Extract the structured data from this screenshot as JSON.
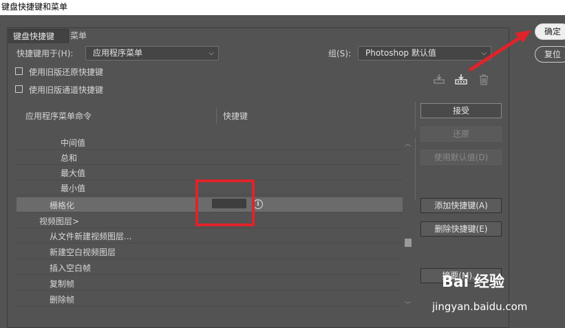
{
  "window": {
    "title": "键盘快捷键和菜单"
  },
  "tabs": [
    {
      "label": "键盘快捷键"
    },
    {
      "label": "菜单"
    }
  ],
  "shortcuts_for": {
    "label": "快捷键用于(H):",
    "value": "应用程序菜单"
  },
  "group": {
    "label": "组(S):",
    "value": "Photoshop 默认值"
  },
  "options": {
    "legacy_undo": "使用旧版还原快捷键",
    "legacy_channel": "使用旧版通道快捷键"
  },
  "icons": {
    "save_set": "save-set-icon",
    "save_as_set": "save-as-set-icon",
    "delete_set": "trash-icon"
  },
  "list": {
    "col_command": "应用程序菜单命令",
    "col_shortcut": "快捷键",
    "rows": [
      {
        "label": "中间值"
      },
      {
        "label": "总和"
      },
      {
        "label": "最大值"
      },
      {
        "label": "最小值"
      },
      {
        "label": "栅格化"
      },
      {
        "label": "视频图层>"
      },
      {
        "label": "从文件新建视频图层..."
      },
      {
        "label": "新建空白视频图层"
      },
      {
        "label": "插入空白帧"
      },
      {
        "label": "复制帧"
      },
      {
        "label": "删除帧"
      }
    ]
  },
  "buttons": {
    "accept": "接受",
    "undo": "还原",
    "use_default": "使用默认值(D)",
    "add_shortcut": "添加快捷键(A)",
    "delete_shortcut": "删除快捷键(E)",
    "summary": "摘要(M)..."
  },
  "dialog": {
    "ok": "确定",
    "reset": "复位"
  },
  "watermark": {
    "brand": "Bai 经验",
    "url": "jingyan.baidu.com"
  },
  "colors": {
    "highlight": "#e0232a",
    "background": "#535353"
  }
}
